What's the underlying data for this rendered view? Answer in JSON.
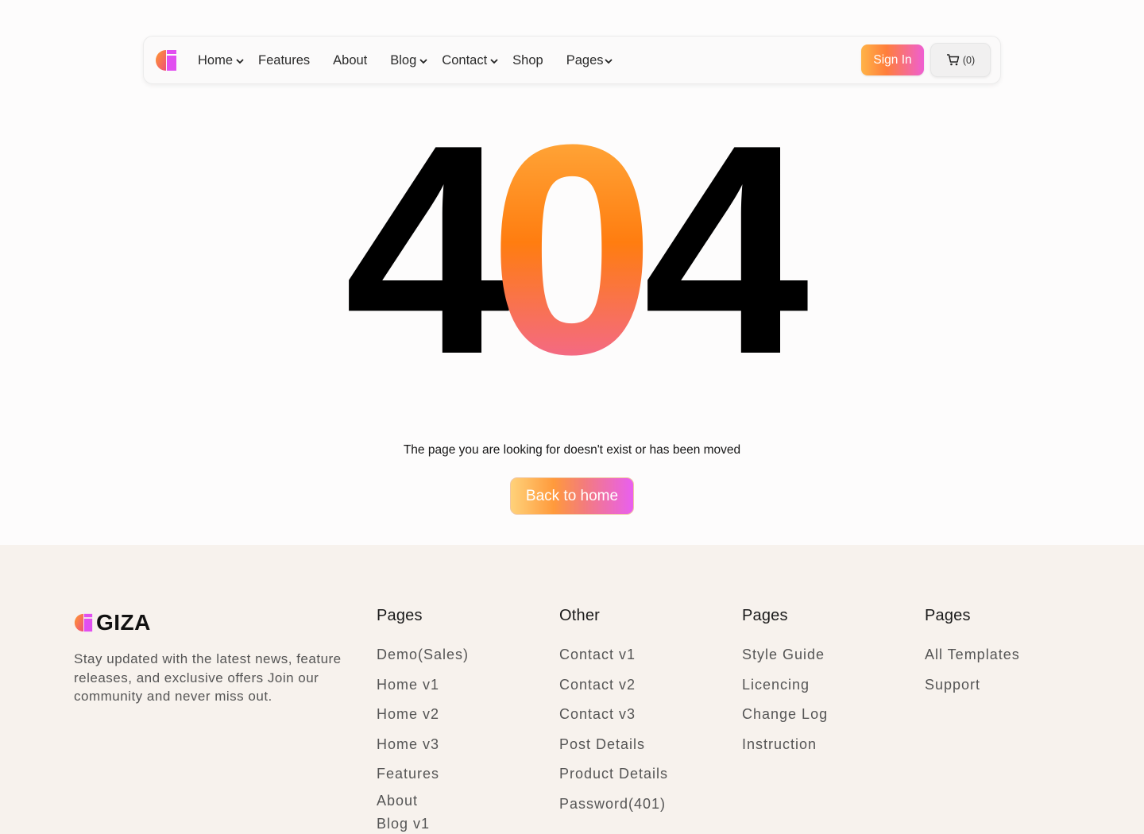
{
  "nav": {
    "items": [
      {
        "label": "Home",
        "dropdown": true
      },
      {
        "label": "Features",
        "dropdown": false
      },
      {
        "label": "About",
        "dropdown": false
      },
      {
        "label": "Blog",
        "dropdown": true
      },
      {
        "label": "Contact",
        "dropdown": true
      },
      {
        "label": "Shop",
        "dropdown": false
      },
      {
        "label": "Pages",
        "dropdown": true
      }
    ],
    "signin_label": "Sign In",
    "cart_label": "(0)"
  },
  "hero": {
    "code_left": "4",
    "code_middle": "0",
    "code_right": "4",
    "message": "The page you are looking for doesn't exist or has been moved",
    "back_button": "Back to home"
  },
  "footer": {
    "brand": "GIZA",
    "tagline": "Stay updated with the latest news, feature releases, and exclusive offers Join our community and never miss out.",
    "columns": [
      {
        "title": "Pages",
        "links": [
          "Demo(Sales)",
          "Home v1",
          "Home v2",
          "Home v3",
          "Features",
          "About",
          "Blog v1"
        ]
      },
      {
        "title": "Other",
        "links": [
          "Contact v1",
          "Contact v2",
          "Contact v3",
          "Post Details",
          "Product Details",
          "Password(401)"
        ]
      },
      {
        "title": "Pages",
        "links": [
          "Style Guide",
          "Licencing",
          "Change Log",
          "Instruction"
        ]
      },
      {
        "title": "Pages",
        "links": [
          "All Templates",
          "Support"
        ]
      }
    ]
  },
  "colors": {
    "accent_orange": "#ff7e1a",
    "accent_pink": "#ee5fc8",
    "footer_bg": "#f7f2ed"
  }
}
